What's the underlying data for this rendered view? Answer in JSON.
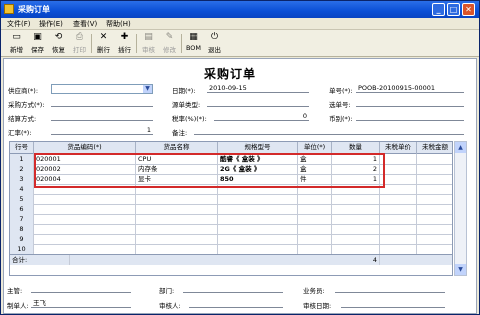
{
  "window": {
    "title": "采购订单"
  },
  "menu": [
    "文件(F)",
    "操作(E)",
    "查看(V)",
    "帮助(H)"
  ],
  "toolbar": [
    {
      "label": "新增",
      "icon": "new-icon",
      "glyph": "▭",
      "disabled": false
    },
    {
      "label": "保存",
      "icon": "save-icon",
      "glyph": "▣",
      "disabled": false
    },
    {
      "label": "恢复",
      "icon": "restore-icon",
      "glyph": "⟲",
      "disabled": false
    },
    {
      "label": "打印",
      "icon": "print-icon",
      "glyph": "⎙",
      "disabled": true
    },
    {
      "label": "删行",
      "icon": "delete-row-icon",
      "glyph": "✕",
      "disabled": false
    },
    {
      "label": "插行",
      "icon": "insert-row-icon",
      "glyph": "✚",
      "disabled": false
    },
    {
      "label": "审核",
      "icon": "approve-icon",
      "glyph": "▤",
      "disabled": true
    },
    {
      "label": "修改",
      "icon": "edit-icon",
      "glyph": "✎",
      "disabled": true
    },
    {
      "label": "BOM",
      "icon": "bom-icon",
      "glyph": "▦",
      "disabled": false
    },
    {
      "label": "退出",
      "icon": "exit-icon",
      "glyph": "⏻",
      "disabled": false
    }
  ],
  "doc_title": "采购订单",
  "header": {
    "supplier_label": "供应商(*):",
    "supplier_value": "",
    "purchase_method_label": "采购方式(*):",
    "settlement_label": "结算方式:",
    "exchange_rate_label": "汇率(*):",
    "exchange_rate_value": "1",
    "date_label": "日期(*):",
    "date_value": "2010-09-15",
    "source_type_label": "源单类型:",
    "tax_rate_label": "税率(%)(*):",
    "tax_rate_value": "0",
    "remark_label": "备注:",
    "order_no_label": "单号(*):",
    "order_no_value": "POOB-20100915-00001",
    "source_no_label": "选单号:",
    "currency_label": "币别(*):"
  },
  "table": {
    "columns": [
      "行号",
      "货品编码(*)",
      "货品名称",
      "规格型号",
      "单位(*)",
      "数量",
      "未税单价",
      "未税金额"
    ],
    "rows": [
      {
        "no": "1",
        "code": "020001",
        "name": "CPU",
        "spec": "酷睿《 盒装 》",
        "unit": "盒",
        "qty": "1"
      },
      {
        "no": "2",
        "code": "020002",
        "name": "内存条",
        "spec": "2G《 盒装 》",
        "unit": "盒",
        "qty": "2"
      },
      {
        "no": "3",
        "code": "020004",
        "name": "显卡",
        "spec": "850",
        "unit": "件",
        "qty": "1"
      },
      {
        "no": "4",
        "code": "",
        "name": "",
        "spec": "",
        "unit": "",
        "qty": ""
      },
      {
        "no": "5",
        "code": "",
        "name": "",
        "spec": "",
        "unit": "",
        "qty": ""
      },
      {
        "no": "6",
        "code": "",
        "name": "",
        "spec": "",
        "unit": "",
        "qty": ""
      },
      {
        "no": "7",
        "code": "",
        "name": "",
        "spec": "",
        "unit": "",
        "qty": ""
      },
      {
        "no": "8",
        "code": "",
        "name": "",
        "spec": "",
        "unit": "",
        "qty": ""
      },
      {
        "no": "9",
        "code": "",
        "name": "",
        "spec": "",
        "unit": "",
        "qty": ""
      },
      {
        "no": "10",
        "code": "",
        "name": "",
        "spec": "",
        "unit": "",
        "qty": ""
      }
    ],
    "total_label": "合计:",
    "total_qty": "4"
  },
  "footer": {
    "supervisor_label": "主管:",
    "department_label": "部门:",
    "salesperson_label": "业务员:",
    "maker_label": "制单人:",
    "maker_value": "王飞",
    "reviewer_label": "审核人:",
    "review_date_label": "审核日期:"
  },
  "colors": {
    "highlight": "#d32a2a",
    "titlebar": "#0a4fd6"
  }
}
